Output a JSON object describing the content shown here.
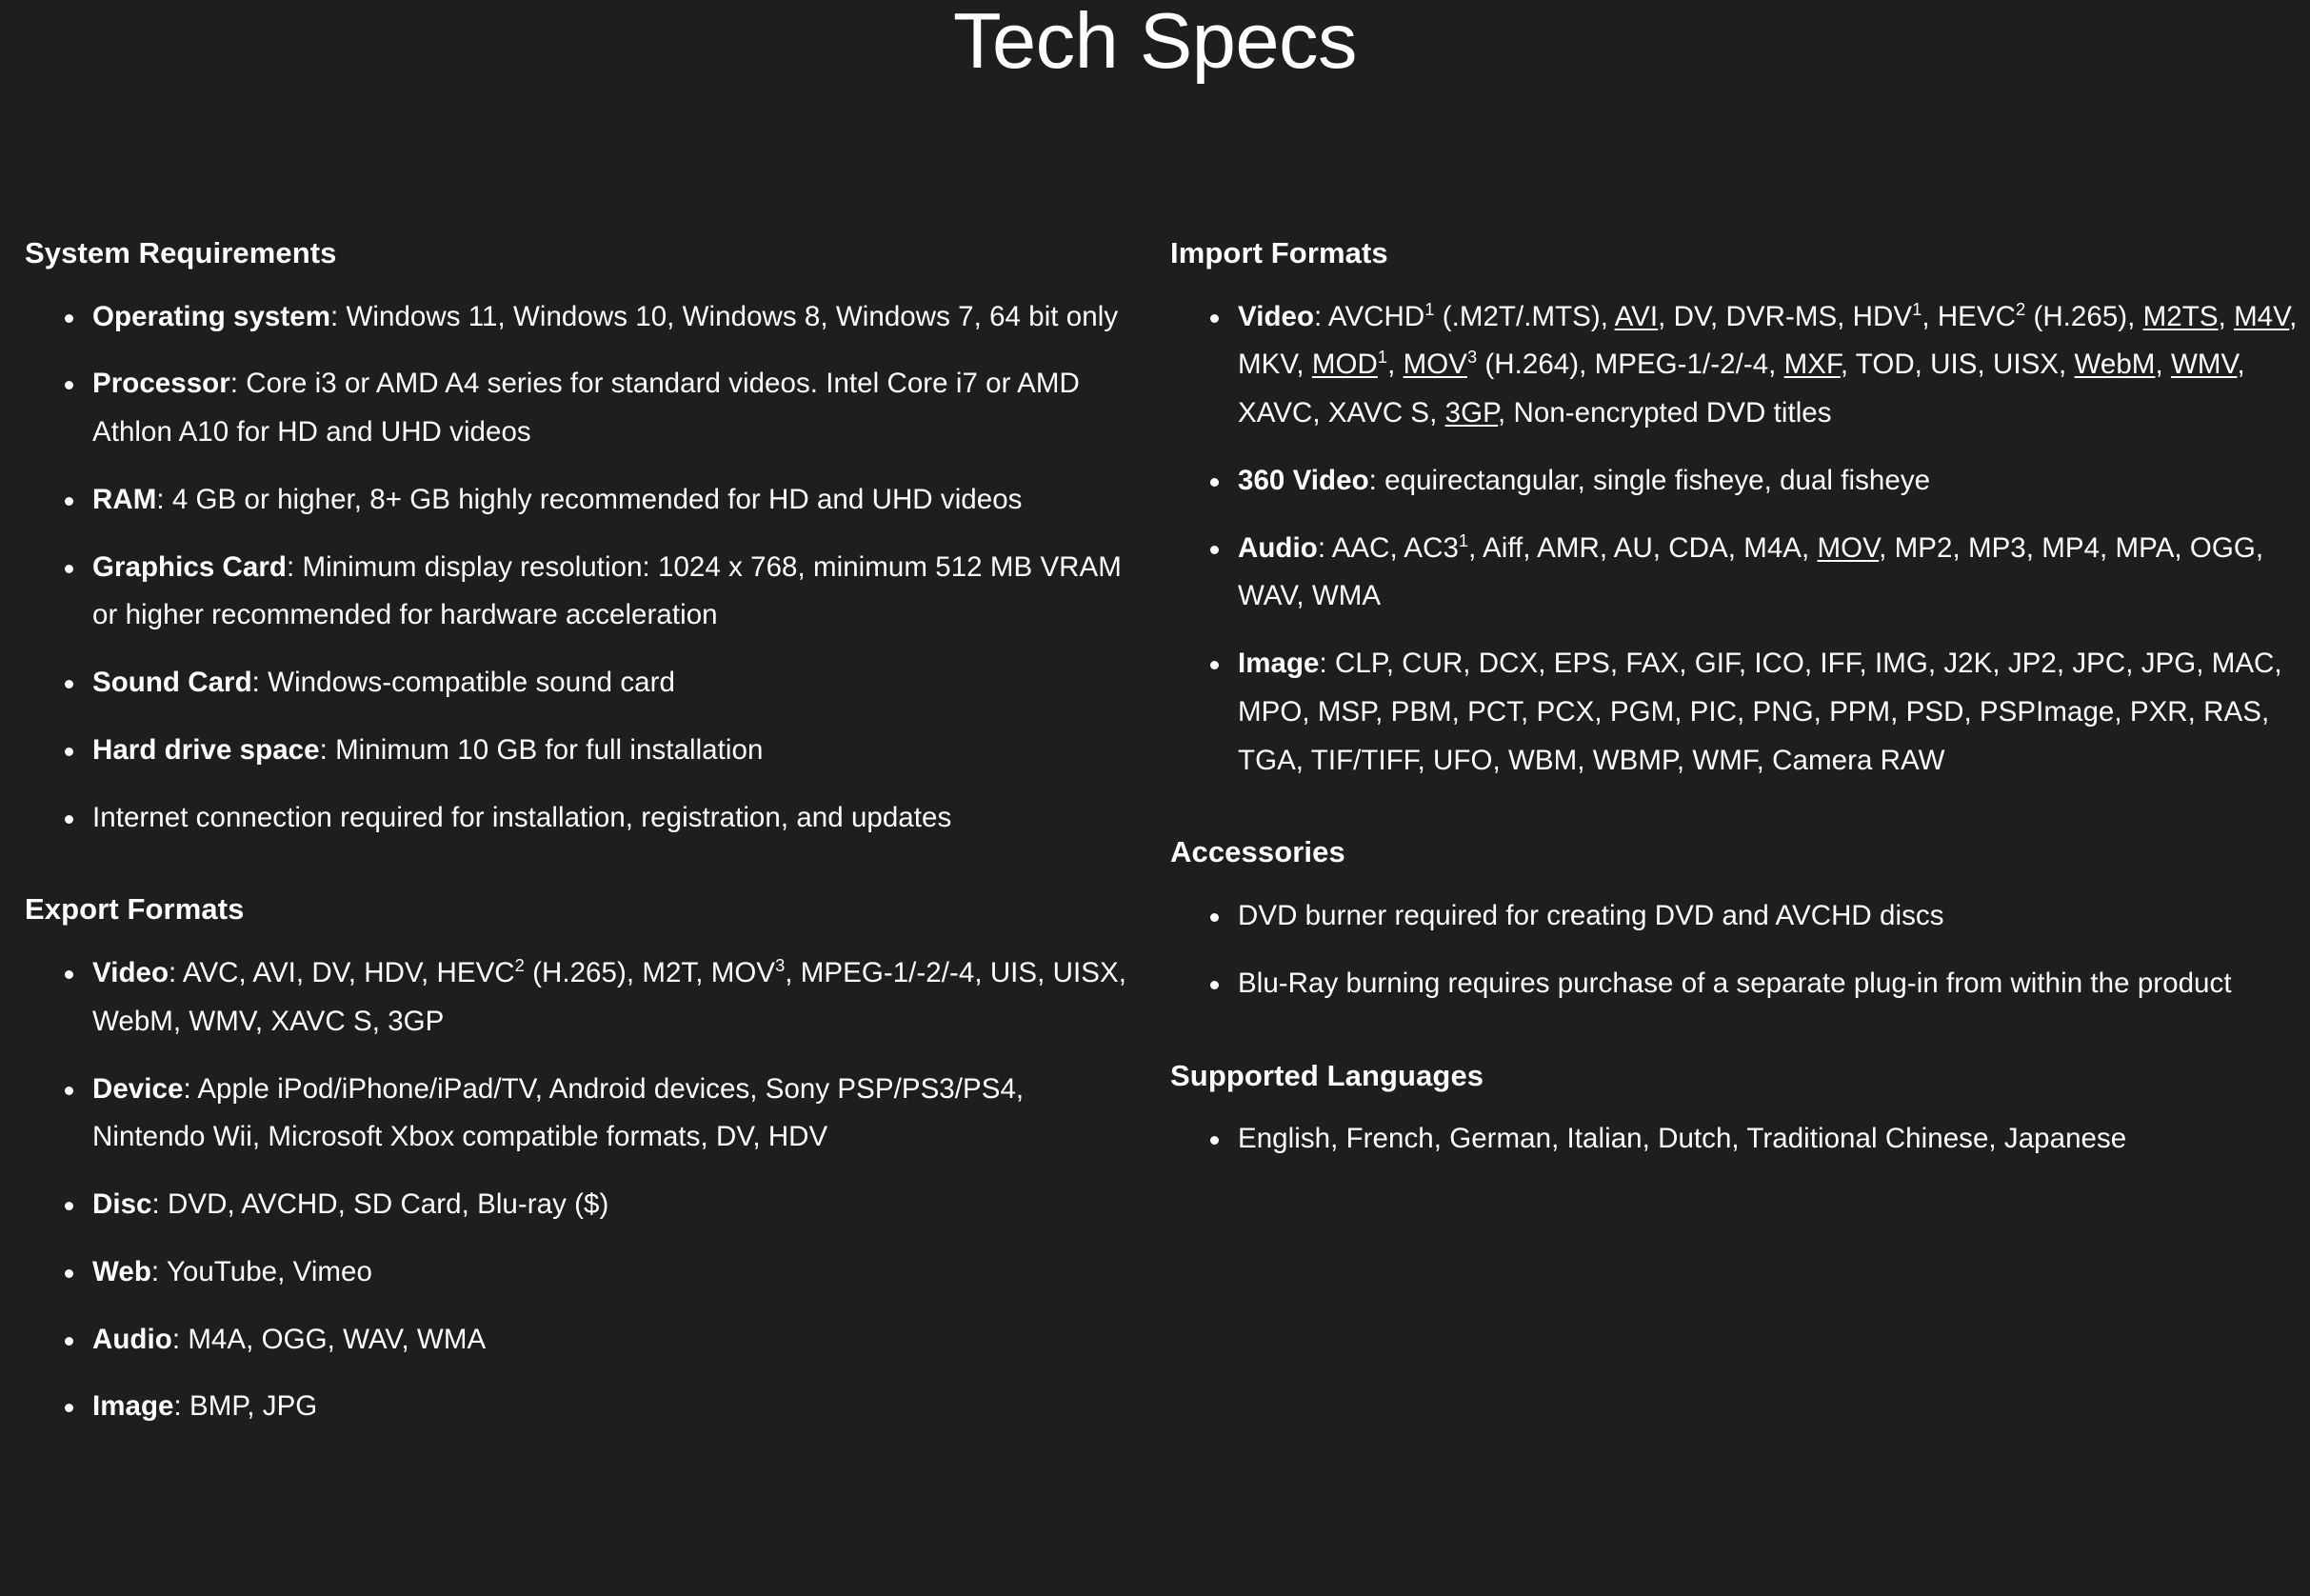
{
  "header": {
    "title": "Tech Specs"
  },
  "left_column": {
    "sections": [
      {
        "id": "system-requirements",
        "title": "System Requirements",
        "items": [
          {
            "label": "Operating system",
            "text": "Windows 11, Windows 10, Windows 8, Windows 7, 64 bit only"
          },
          {
            "label": "Processor",
            "text": "Core i3 or AMD A4 series for standard videos. Intel Core i7 or AMD Athlon A10 for HD and UHD videos"
          },
          {
            "label": "RAM",
            "text": "4 GB or higher, 8+ GB highly recommended for HD and UHD videos"
          },
          {
            "label": "Graphics Card",
            "text": "Minimum display resolution: 1024 x 768, minimum 512 MB VRAM or higher recommended for hardware acceleration"
          },
          {
            "label": "Sound Card",
            "text": "Windows-compatible sound card"
          },
          {
            "label": "Hard drive space",
            "text": "Minimum 10 GB for full installation"
          },
          {
            "label": "",
            "text": "Internet connection required for installation, registration, and updates"
          }
        ]
      },
      {
        "id": "export-formats",
        "title": "Export Formats",
        "items": [
          {
            "label": "Video",
            "text": "AVC, AVI, DV, HDV, HEVC2 (H.265), M2T, MOV3, MPEG-1/-2/-4, UIS, UISX, WebM, WMV, XAVC S, 3GP"
          },
          {
            "label": "Device",
            "text": "Apple iPod/iPhone/iPad/TV, Android devices, Sony PSP/PS3/PS4, Nintendo Wii, Microsoft Xbox compatible formats, DV, HDV"
          },
          {
            "label": "Disc",
            "text": "DVD, AVCHD, SD Card, Blu-ray ($)"
          },
          {
            "label": "Web",
            "text": "YouTube, Vimeo"
          },
          {
            "label": "Audio",
            "text": "M4A, OGG, WAV, WMA"
          },
          {
            "label": "Image",
            "text": "BMP, JPG"
          }
        ]
      }
    ]
  },
  "right_column": {
    "sections": [
      {
        "id": "import-formats",
        "title": "Import Formats",
        "items": [
          {
            "label": "Video",
            "text": "AVCHD1 (.M2T/.MTS), AVI, DV, DVR-MS, HDV1, HEVC2 (H.265), M2TS, M4V, MKV, MOD1, MOV3 (H.264), MPEG-1/-2/-4, MXF, TOD, UIS, UISX, WebM, WMV, XAVC, XAVC S, 3GP, Non-encrypted DVD titles"
          },
          {
            "label": "360 Video",
            "text": "equirectangular, single fisheye, dual fisheye"
          },
          {
            "label": "Audio",
            "text": "AAC, AC31, Aiff, AMR, AU, CDA, M4A, MOV, MP2, MP3, MP4, MPA, OGG, WAV, WMA"
          },
          {
            "label": "Image",
            "text": "CLP, CUR, DCX, EPS, FAX, GIF, ICO, IFF, IMG, J2K, JP2, JPC, JPG, MAC, MPO, MSP, PBM, PCT, PCX, PGM, PIC, PNG, PPM, PSD, PSPImage, PXR, RAS, TGA, TIF/TIFF, UFO, WBM, WBMP, WMF, Camera RAW"
          }
        ]
      },
      {
        "id": "accessories",
        "title": "Accessories",
        "items": [
          {
            "label": "",
            "text": "DVD burner required for creating DVD and AVCHD discs"
          },
          {
            "label": "",
            "text": "Blu-Ray burning requires purchase of a separate plug-in from within the product"
          }
        ]
      },
      {
        "id": "supported-languages",
        "title": "Supported Languages",
        "items": [
          {
            "label": "",
            "text": "English, French, German, Italian, Dutch, Traditional Chinese, Japanese"
          }
        ]
      }
    ]
  },
  "formatting": {
    "superscript_markers": {
      "import_video": [
        {
          "token": "AVCHD",
          "sup": "1"
        },
        {
          "token": "HDV",
          "sup": "1"
        },
        {
          "token": "HEVC",
          "sup": "2"
        },
        {
          "token": "MOD",
          "sup": "1"
        },
        {
          "token": "MOV",
          "sup": "3"
        }
      ],
      "import_audio": [
        {
          "token": "AC3",
          "sup": "1"
        }
      ],
      "export_video": [
        {
          "token": "HEVC",
          "sup": "2"
        },
        {
          "token": "MOV",
          "sup": "3"
        }
      ]
    },
    "underlined_tokens": [
      "AVI",
      "M2TS",
      "M4V",
      "MOD",
      "MOV",
      "MXF",
      "WebM",
      "WMV",
      "3GP"
    ],
    "colors": {
      "background": "#1e1e1e",
      "text": "#ffffff",
      "bullet": "#ffffff"
    }
  }
}
